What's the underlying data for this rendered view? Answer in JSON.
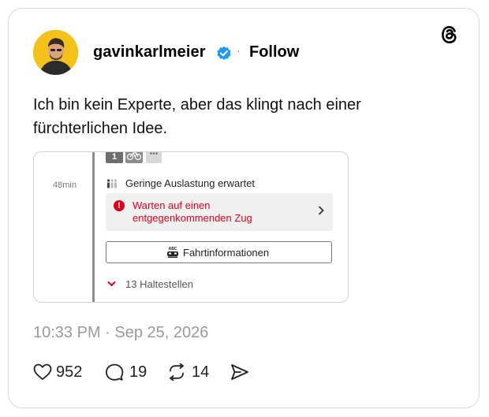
{
  "post": {
    "username": "gavinkarlmeier",
    "separator": "·",
    "follow_label": "Follow",
    "text": "Ich bin kein Experte, aber das klingt nach einer fürchterlichen Idee.",
    "timestamp": "10:33 PM · Sep 25, 2026"
  },
  "embed": {
    "duration": "48min",
    "badge_1": "1",
    "badge_3": "•••",
    "occupancy": "Geringe Auslastung erwartet",
    "warning_line1": "Warten auf einen",
    "warning_line2": "entgegenkommenden Zug",
    "info_button": "Fahrtinformationen",
    "stops": "13 Haltestellen"
  },
  "actions": {
    "likes": "952",
    "replies": "19",
    "reposts": "14"
  },
  "icons": {
    "verified": "verified-badge-icon",
    "threads": "threads-logo-icon",
    "like": "heart-icon",
    "reply": "speech-bubble-icon",
    "repost": "repost-icon",
    "share": "paper-plane-icon"
  },
  "colors": {
    "verified": "#1d9bf0",
    "warning_red": "#e0001b",
    "avatar_bg": "#f2c21b",
    "timestamp_gray": "#9a9a9a"
  }
}
